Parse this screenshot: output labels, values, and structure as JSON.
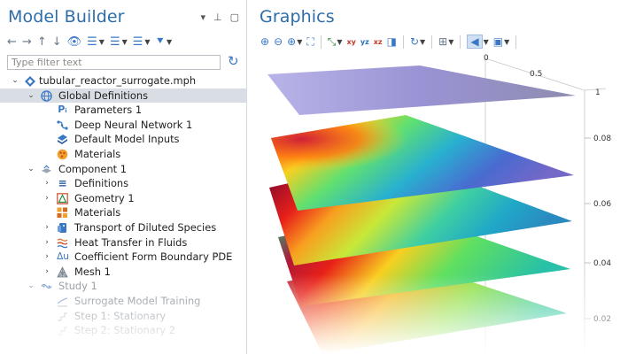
{
  "model_builder": {
    "title": "Model Builder",
    "filter_placeholder": "Type filter text",
    "tree": [
      {
        "label": "tubular_reactor_surrogate.mph",
        "icon": "model-file-icon",
        "expanded": true
      },
      {
        "label": "Global Definitions",
        "icon": "globe-icon",
        "expanded": true,
        "selected": true
      },
      {
        "label": "Parameters 1",
        "icon": "parameters-icon"
      },
      {
        "label": "Deep Neural Network 1",
        "icon": "neural-network-icon"
      },
      {
        "label": "Default Model Inputs",
        "icon": "model-inputs-icon"
      },
      {
        "label": "Materials",
        "icon": "materials-icon"
      },
      {
        "label": "Component 1",
        "icon": "component-icon",
        "expanded": true
      },
      {
        "label": "Definitions",
        "icon": "definitions-icon"
      },
      {
        "label": "Geometry 1",
        "icon": "geometry-icon"
      },
      {
        "label": "Materials",
        "icon": "materials-icon"
      },
      {
        "label": "Transport of Diluted Species",
        "icon": "transport-icon"
      },
      {
        "label": "Heat Transfer in Fluids",
        "icon": "heat-transfer-icon"
      },
      {
        "label": "Coefficient Form Boundary PDE",
        "icon": "coefficient-form-icon"
      },
      {
        "label": "Mesh 1",
        "icon": "mesh-icon"
      },
      {
        "label": "Study 1",
        "icon": "study-icon",
        "expanded": true
      },
      {
        "label": "Surrogate Model Training",
        "icon": "training-icon"
      },
      {
        "label": "Step 1: Stationary",
        "icon": "step-icon"
      },
      {
        "label": "Step 2: Stationary 2",
        "icon": "step-icon"
      }
    ],
    "pde_prefix": "Δu"
  },
  "graphics": {
    "title": "Graphics",
    "axis_ticks_top": [
      "0",
      "0.5",
      "1"
    ],
    "axis_ticks_right": [
      "0.08",
      "0.06",
      "0.04",
      "0.02"
    ]
  },
  "colors": {
    "title_blue": "#2e6da8",
    "selection": "#d9dee5",
    "icon_blue": "#3a78c4"
  }
}
